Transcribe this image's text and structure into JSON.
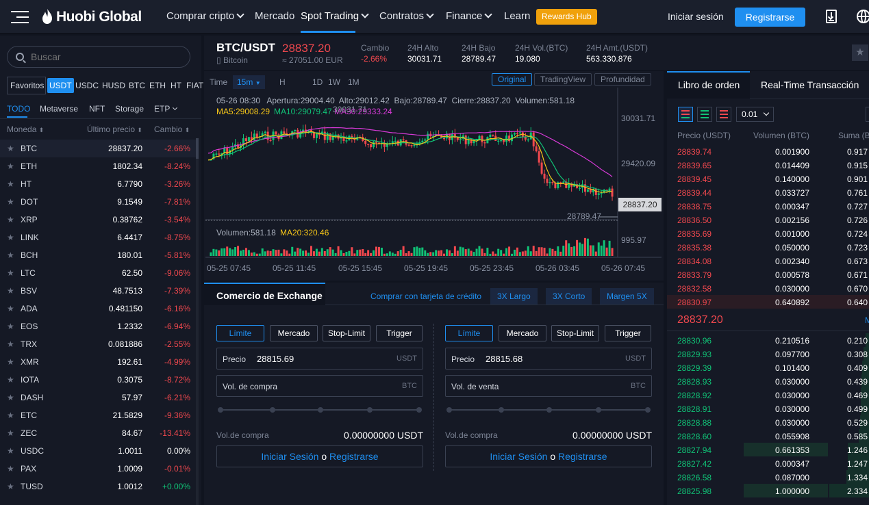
{
  "nav": {
    "logo": "Huobi Global",
    "buy_crypto": "Comprar cripto",
    "market": "Mercado",
    "spot": "Spot Trading",
    "contracts": "Contratos",
    "finance": "Finance",
    "learn": "Learn",
    "rewards": "Rewards Hub",
    "login": "Iniciar sesión",
    "register": "Registrarse"
  },
  "market": {
    "search_placeholder": "Buscar",
    "quote_tabs": [
      "Favoritos",
      "USDT",
      "USDC",
      "HUSD",
      "BTC",
      "ETH",
      "HT",
      "FIAT"
    ],
    "cat_tabs": [
      "TODO",
      "Metaverse",
      "NFT",
      "Storage",
      "ETP"
    ],
    "cols": {
      "coin": "Moneda",
      "price": "Último precio",
      "change": "Cambio"
    },
    "rows": [
      {
        "sym": "BTC",
        "price": "28837.20",
        "chg": "-2.66%",
        "dir": "neg"
      },
      {
        "sym": "ETH",
        "price": "1802.34",
        "chg": "-8.24%",
        "dir": "neg"
      },
      {
        "sym": "HT",
        "price": "6.7790",
        "chg": "-3.26%",
        "dir": "neg"
      },
      {
        "sym": "DOT",
        "price": "9.1549",
        "chg": "-7.81%",
        "dir": "neg"
      },
      {
        "sym": "XRP",
        "price": "0.38762",
        "chg": "-3.54%",
        "dir": "neg"
      },
      {
        "sym": "LINK",
        "price": "6.4417",
        "chg": "-8.75%",
        "dir": "neg"
      },
      {
        "sym": "BCH",
        "price": "180.01",
        "chg": "-5.81%",
        "dir": "neg"
      },
      {
        "sym": "LTC",
        "price": "62.50",
        "chg": "-9.06%",
        "dir": "neg"
      },
      {
        "sym": "BSV",
        "price": "48.7513",
        "chg": "-7.39%",
        "dir": "neg"
      },
      {
        "sym": "ADA",
        "price": "0.481150",
        "chg": "-6.16%",
        "dir": "neg"
      },
      {
        "sym": "EOS",
        "price": "1.2332",
        "chg": "-6.94%",
        "dir": "neg"
      },
      {
        "sym": "TRX",
        "price": "0.081886",
        "chg": "-2.55%",
        "dir": "neg"
      },
      {
        "sym": "XMR",
        "price": "192.61",
        "chg": "-4.99%",
        "dir": "neg"
      },
      {
        "sym": "IOTA",
        "price": "0.3075",
        "chg": "-8.72%",
        "dir": "neg"
      },
      {
        "sym": "DASH",
        "price": "57.97",
        "chg": "-6.21%",
        "dir": "neg"
      },
      {
        "sym": "ETC",
        "price": "21.5829",
        "chg": "-9.36%",
        "dir": "neg"
      },
      {
        "sym": "ZEC",
        "price": "84.67",
        "chg": "-13.41%",
        "dir": "neg"
      },
      {
        "sym": "USDC",
        "price": "1.0011",
        "chg": "0.00%",
        "dir": "flat"
      },
      {
        "sym": "PAX",
        "price": "1.0009",
        "chg": "-0.01%",
        "dir": "neg"
      },
      {
        "sym": "TUSD",
        "price": "1.0012",
        "chg": "+0.00%",
        "dir": "pos"
      }
    ]
  },
  "ticker": {
    "pair": "BTC/USDT",
    "name": "Bitcoin",
    "price": "28837.20",
    "eur": "≈ 27051.00 EUR",
    "change_l": "Cambio",
    "change_v": "-2.66%",
    "high_l": "24H Alto",
    "high_v": "30031.71",
    "low_l": "24H Bajo",
    "low_v": "28789.47",
    "vol_l": "24H Vol.(BTC)",
    "vol_v": "19.080",
    "amt_l": "24H Amt.(USDT)",
    "amt_v": "563.330.876"
  },
  "chart": {
    "time_label": "Time",
    "intervals": [
      "15m",
      "H",
      "1D",
      "1W",
      "1M"
    ],
    "views": [
      "Original",
      "TradingView",
      "Profundidad"
    ],
    "ohlc": "05-26 08:30   Apertura:29004.40  Alto:29012.42  Bajo:28789.47  Cierre:28837.20  Volumen:581.18",
    "ma5": "MA5:29008.29",
    "ma10": "MA10:29079.47",
    "ma30": "MA30:29333.24",
    "hi_mark": "30031.71",
    "y_ticks": [
      "30031.71",
      "29420.09"
    ],
    "last_price": "28837.20",
    "low_mark": "28789.47",
    "vol_label": "Volumen:581.18",
    "ma20_vol": "MA20:320.46",
    "vol_tick": "995.97",
    "x_ticks": [
      "05-25 07:45",
      "05-25 11:45",
      "05-25 15:45",
      "05-25 19:45",
      "05-25 23:45",
      "05-26 03:45",
      "05-26 07:45"
    ]
  },
  "trade": {
    "title": "Comercio de Exchange",
    "credit": "Comprar con tarjeta de crédito",
    "long3x": "3X Largo",
    "short3x": "3X Corto",
    "margin5x": "Margen 5X",
    "types": [
      "Límite",
      "Mercado",
      "Stop-Limit",
      "Trigger"
    ],
    "buy": {
      "price_l": "Precio",
      "price_v": "28815.69",
      "price_u": "USDT",
      "vol_l": "Vol. de compra",
      "vol_u": "BTC",
      "avail_l": "Vol.de compra",
      "avail_v": "0.00000000 USDT"
    },
    "sell": {
      "price_l": "Precio",
      "price_v": "28815.68",
      "price_u": "USDT",
      "vol_l": "Vol. de venta",
      "vol_u": "BTC",
      "avail_l": "Vol.de compra",
      "avail_v": "0.00000000 USDT"
    },
    "login": "Iniciar Sesión",
    "or": "o",
    "register": "Registrarse"
  },
  "book": {
    "tab1": "Libro de orden",
    "tab2": "Real-Time Transacción",
    "precision": "0.01",
    "h_price": "Precio (USDT)",
    "h_vol": "Volumen (BTC)",
    "h_sum": "Suma (B",
    "asks": [
      [
        "28839.74",
        "0.001900",
        "0.917"
      ],
      [
        "28839.65",
        "0.014409",
        "0.915"
      ],
      [
        "28839.45",
        "0.140000",
        "0.901"
      ],
      [
        "28839.44",
        "0.033727",
        "0.761"
      ],
      [
        "28838.75",
        "0.000347",
        "0.727"
      ],
      [
        "28836.50",
        "0.002156",
        "0.726"
      ],
      [
        "28835.69",
        "0.001000",
        "0.724"
      ],
      [
        "28835.38",
        "0.050000",
        "0.723"
      ],
      [
        "28834.08",
        "0.002340",
        "0.673"
      ],
      [
        "28833.79",
        "0.000578",
        "0.671"
      ],
      [
        "28832.58",
        "0.030000",
        "0.670"
      ],
      [
        "28830.97",
        "0.640892",
        "0.640"
      ]
    ],
    "mid": "28837.20",
    "mid_right": "M",
    "bids": [
      [
        "28830.96",
        "0.210516",
        "0.210"
      ],
      [
        "28829.93",
        "0.097700",
        "0.308"
      ],
      [
        "28829.39",
        "0.101400",
        "0.409"
      ],
      [
        "28828.93",
        "0.030000",
        "0.439"
      ],
      [
        "28828.92",
        "0.030000",
        "0.469"
      ],
      [
        "28828.91",
        "0.030000",
        "0.499"
      ],
      [
        "28828.88",
        "0.030000",
        "0.529"
      ],
      [
        "28828.60",
        "0.055908",
        "0.585"
      ],
      [
        "28827.94",
        "0.661353",
        "1.246"
      ],
      [
        "28827.42",
        "0.000347",
        "1.247"
      ],
      [
        "28826.58",
        "0.087000",
        "1.334"
      ],
      [
        "28825.98",
        "1.000000",
        "2.334"
      ]
    ]
  }
}
